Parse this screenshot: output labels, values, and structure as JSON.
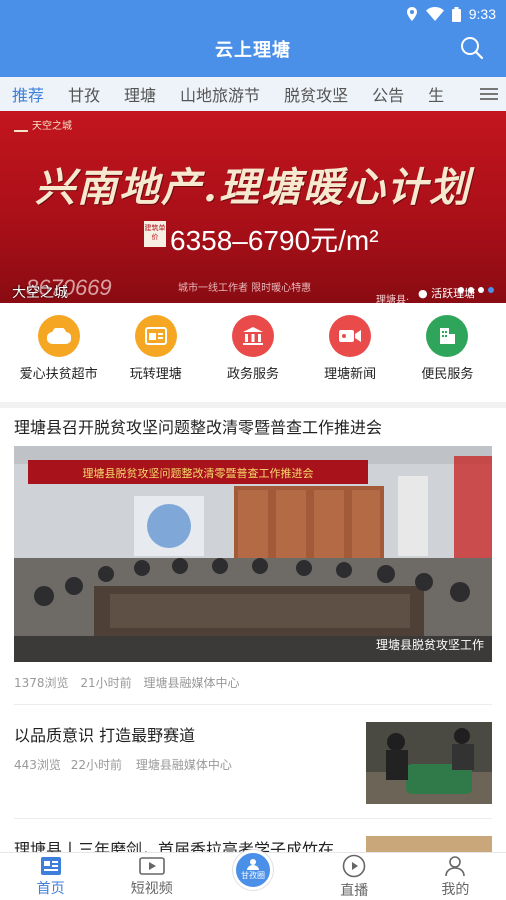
{
  "colors": {
    "primary": "#4a90e8",
    "tab_active": "#3d7fdb",
    "banner_red": "#b0131b"
  },
  "status": {
    "time": "9:33"
  },
  "header": {
    "title": "云上理塘",
    "search_icon": "search-icon"
  },
  "tabs": [
    {
      "label": "推荐",
      "active": true
    },
    {
      "label": "甘孜"
    },
    {
      "label": "理塘"
    },
    {
      "label": "山地旅游节"
    },
    {
      "label": "脱贫攻坚"
    },
    {
      "label": "公告"
    },
    {
      "label": "生"
    }
  ],
  "banner": {
    "brand": "天空之城",
    "headline": "兴南地产.理塘暖心计划",
    "price_tag": "建筑单价",
    "price": "6358–6790元/m²",
    "tagline": "城市一线工作者  限时暖心特惠",
    "phone": "8670669",
    "source": "理塘县·",
    "watermark": "活跃理塘",
    "caption": "大空之城"
  },
  "quick_links": [
    {
      "label": "爱心扶贫超市",
      "color": "#f5a623",
      "icon": "cloud-icon"
    },
    {
      "label": "玩转理塘",
      "color": "#f5a623",
      "icon": "browser-icon"
    },
    {
      "label": "政务服务",
      "color": "#e94b4b",
      "icon": "government-icon"
    },
    {
      "label": "理塘新闻",
      "color": "#e94b4b",
      "icon": "video-camera-icon"
    },
    {
      "label": "便民服务",
      "color": "#2ea55a",
      "icon": "building-icon"
    }
  ],
  "articles": [
    {
      "title": "理塘县召开脱贫攻坚问题整改清零暨普查工作推进会",
      "views": "1378浏览",
      "time": "21小时前",
      "source": "理塘县融媒体中心",
      "image_banner": "理塘县脱贫攻坚问题整改清零暨普查工作推进会",
      "image_watermark": "理塘县脱贫攻坚工作"
    },
    {
      "title": "以品质意识 打造最野赛道",
      "views": "443浏览",
      "time": "22小时前",
      "source": "理塘县融媒体中心"
    },
    {
      "title": "理塘县丨三年磨剑，首届香拉高考学子成竹在"
    }
  ],
  "bottom_nav": [
    {
      "label": "首页",
      "icon": "home-icon",
      "active": true
    },
    {
      "label": "短视频",
      "icon": "video-icon"
    },
    {
      "label": "甘孜圈",
      "icon": "community-icon",
      "center": true
    },
    {
      "label": "直播",
      "icon": "play-icon"
    },
    {
      "label": "我的",
      "icon": "user-icon"
    }
  ]
}
